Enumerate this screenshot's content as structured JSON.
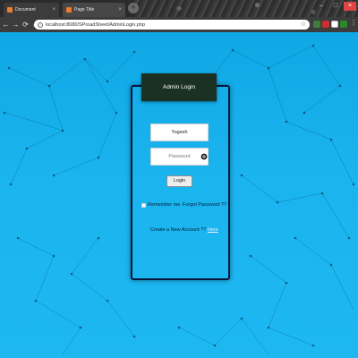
{
  "browser": {
    "tabs": [
      {
        "title": "Document"
      },
      {
        "title": "Page Title"
      }
    ],
    "url": "localhost:8080/SProadSheet/AdminLogin.php",
    "icons": {
      "back": "back-arrow-icon",
      "forward": "forward-arrow-icon",
      "reload": "reload-icon",
      "home": "home-icon",
      "info": "site-info-icon",
      "bookmark": "star-icon",
      "menu": "kebab-menu-icon"
    }
  },
  "login": {
    "header": "Admin Login",
    "username_value": "Yogesh",
    "password_placeholder": "Password",
    "login_button": "Login",
    "remember_me": "Remember me",
    "forgot_password": "Forgot Password ??",
    "create_account_text": "Create a New Account ??",
    "create_account_link": "Here"
  },
  "colors": {
    "background": "#1ab4ef",
    "card_border": "#07173c",
    "header_bg": "#1b3124"
  }
}
